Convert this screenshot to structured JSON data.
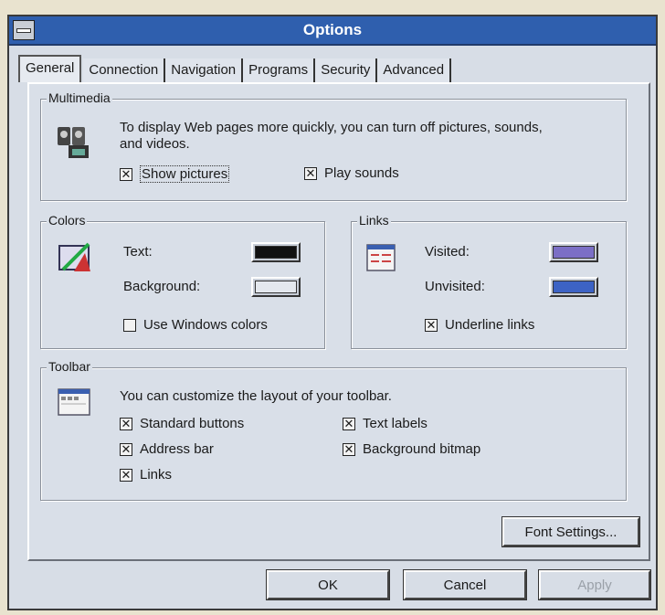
{
  "window": {
    "title": "Options"
  },
  "tabs": [
    {
      "label": "General",
      "active": true
    },
    {
      "label": "Connection"
    },
    {
      "label": "Navigation"
    },
    {
      "label": "Programs"
    },
    {
      "label": "Security"
    },
    {
      "label": "Advanced"
    }
  ],
  "multimedia": {
    "group_label": "Multimedia",
    "desc_line1": "To display Web pages more quickly, you can turn off pictures, sounds,",
    "desc_line2": "and videos.",
    "show_pictures": {
      "label": "Show pictures",
      "checked": true
    },
    "play_sounds": {
      "label": "Play sounds",
      "checked": true
    }
  },
  "colors": {
    "group_label": "Colors",
    "text_label": "Text:",
    "text_color": "#111111",
    "background_label": "Background:",
    "background_color": "#e4e8ee",
    "use_windows_colors": {
      "label": "Use Windows colors",
      "checked": false
    }
  },
  "links": {
    "group_label": "Links",
    "visited_label": "Visited:",
    "visited_color": "#7b6fc6",
    "unvisited_label": "Unvisited:",
    "unvisited_color": "#3d63c4",
    "underline_links": {
      "label": "Underline links",
      "checked": true
    }
  },
  "toolbar": {
    "group_label": "Toolbar",
    "desc": "You can customize the layout of your toolbar.",
    "standard_buttons": {
      "label": "Standard buttons",
      "checked": true
    },
    "address_bar": {
      "label": "Address bar",
      "checked": true
    },
    "links": {
      "label": "Links",
      "checked": true
    },
    "text_labels": {
      "label": "Text labels",
      "checked": true
    },
    "background_bitmap": {
      "label": "Background bitmap",
      "checked": true
    }
  },
  "buttons": {
    "font_settings": "Font Settings...",
    "ok": "OK",
    "cancel": "Cancel",
    "apply": "Apply"
  },
  "check_glyph": "✕"
}
